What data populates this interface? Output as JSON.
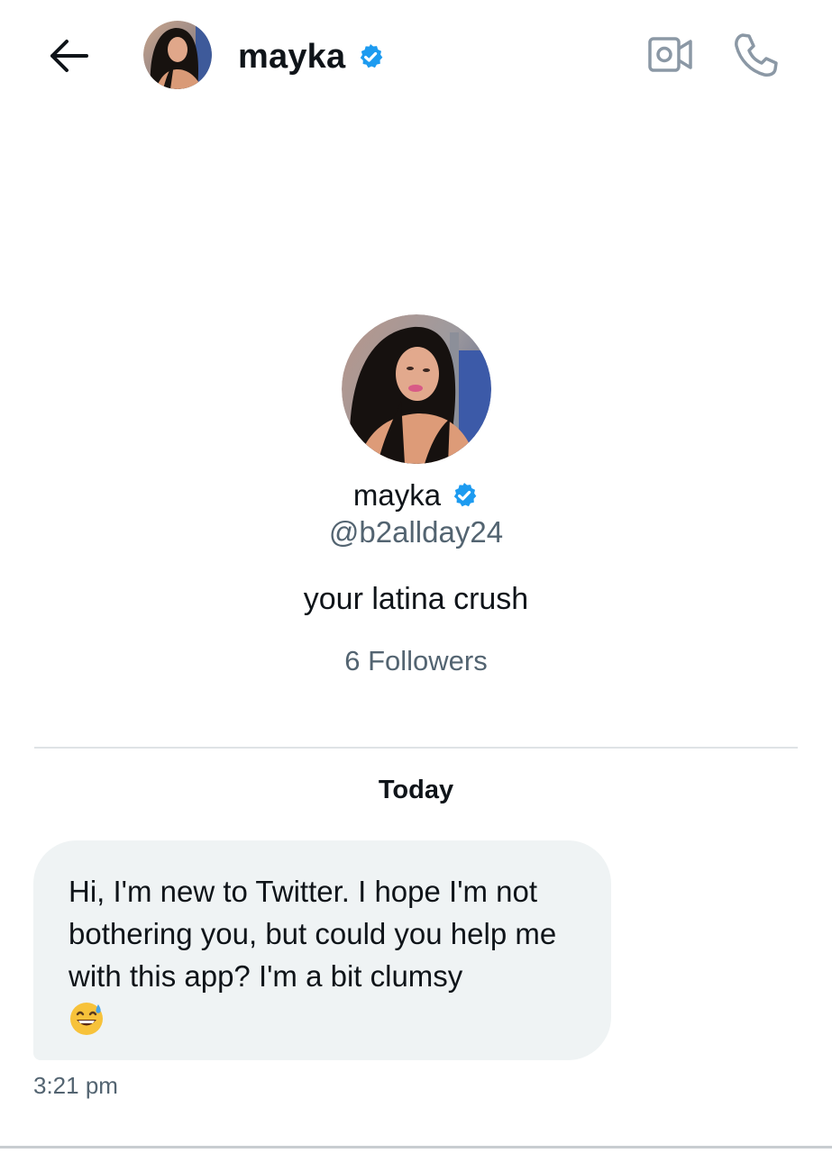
{
  "header": {
    "name": "mayka",
    "icons": {
      "back": "arrow-left-icon",
      "verified": "verified-badge-icon",
      "video": "video-call-icon",
      "call": "phone-icon"
    }
  },
  "profile": {
    "name": "mayka",
    "handle": "@b2allday24",
    "bio": "your latina crush",
    "followers": "6 Followers"
  },
  "conversation": {
    "date_label": "Today",
    "messages": [
      {
        "text": "Hi, I'm new to Twitter. I hope I'm not bothering you, but could you help me with this app? I'm a bit clumsy",
        "emoji": "grinning-face-with-sweat-emoji",
        "time": "3:21 pm"
      }
    ]
  },
  "colors": {
    "verified": "#1d9bf0",
    "text_primary": "#0f1419",
    "text_secondary": "#536471",
    "bubble_bg": "#eff3f4",
    "icon_gray": "#8b98a5"
  }
}
